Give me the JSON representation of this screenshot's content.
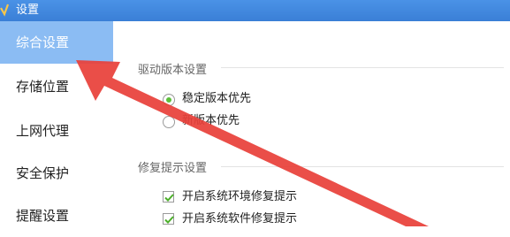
{
  "window": {
    "title": "设置"
  },
  "sidebar": {
    "items": [
      {
        "label": "综合设置",
        "active": true
      },
      {
        "label": "存储位置"
      },
      {
        "label": "上网代理"
      },
      {
        "label": "安全保护"
      },
      {
        "label": "提醒设置"
      }
    ]
  },
  "main": {
    "driver_section": {
      "title": "驱动版本设置",
      "options": [
        {
          "label": "稳定版本优先",
          "selected": true
        },
        {
          "label": "新版本优先",
          "selected": false
        }
      ]
    },
    "repair_section": {
      "title": "修复提示设置",
      "checks": [
        {
          "label": "开启系统环境修复提示",
          "checked": true
        },
        {
          "label": "开启系统软件修复提示",
          "checked": true
        }
      ]
    }
  },
  "colors": {
    "titlebar": "#3a7fd6",
    "sidebar_active": "#8bbcf3",
    "radio_selected": "#5cbf3a",
    "check_mark": "#4caf2a",
    "annotation_arrow": "#e8413a"
  }
}
